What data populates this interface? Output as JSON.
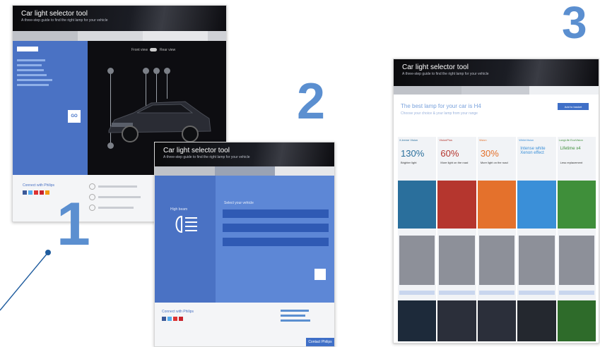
{
  "badges": {
    "one": "1",
    "two": "2",
    "three": "3"
  },
  "panel1": {
    "title": "Car light selector tool",
    "subtitle": "A three-step guide to find the right lamp for your vehicle",
    "tab_selected": "Find lamp",
    "go_label": "GO",
    "connect_label": "Connect with Philips",
    "view_front": "Front view",
    "view_rear": "Rear view"
  },
  "panel2": {
    "title": "Car light selector tool",
    "subtitle": "A three-step guide to find the right lamp for your vehicle",
    "panel_label": "High beam",
    "select_label": "Select your vehicle",
    "connect_label": "Connect with Philips",
    "footer_button": "Contact Philips"
  },
  "panel3": {
    "title": "Car light selector tool",
    "subtitle": "A three-step guide to find the right lamp for your vehicle",
    "heading": "The best lamp for your car is H4",
    "subheading": "Choose your choice & your lamp from your range",
    "button": "Add to basket",
    "columns": [
      {
        "name": "X-treme Vision",
        "value": "130%",
        "desc": "Brighter light",
        "color": "#2a6f9c"
      },
      {
        "name": "VisionPlus",
        "value": "60%",
        "desc": "More light on the road",
        "color": "#b5362e"
      },
      {
        "name": "Vision",
        "value": "30%",
        "desc": "More light on the road",
        "color": "#e4712c"
      },
      {
        "name": "WhiteVision",
        "value": "Intense white Xenon effect",
        "desc": "",
        "color": "#3a8fd8"
      },
      {
        "name": "LongLife EcoVision",
        "value": "Lifetime x4",
        "desc": "Less replacement",
        "color": "#3f8f3a"
      }
    ]
  },
  "colors": {
    "accent": "#5b8fd0",
    "blue_panel": "#3f6fc7",
    "dark": "#0d0d11"
  }
}
